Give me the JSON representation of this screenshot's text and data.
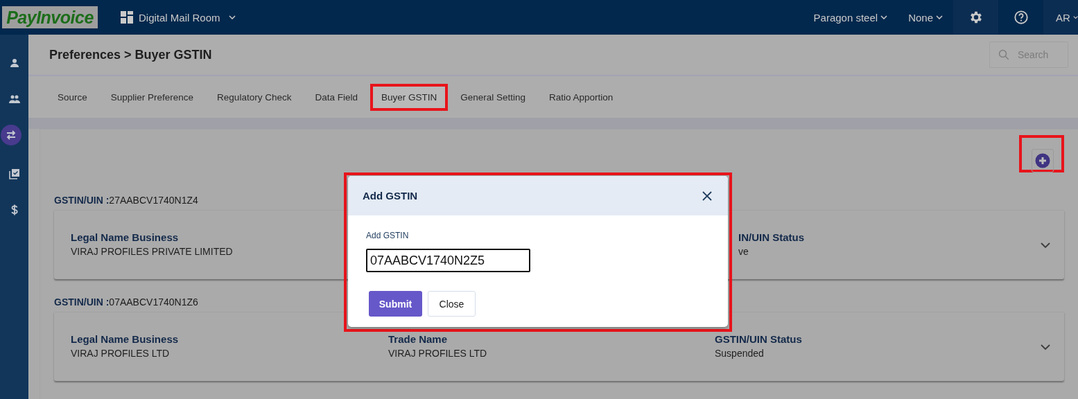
{
  "top_bar": {
    "logo": "PayInvoice",
    "module": "Digital Mail Room",
    "company": "Paragon steel",
    "filter": "None",
    "user": "AR"
  },
  "sidebar": {
    "items": [
      {
        "selected": false
      },
      {
        "selected": false
      },
      {
        "selected": true
      },
      {
        "selected": false
      },
      {
        "selected": false
      }
    ]
  },
  "page_title": "Preferences > Buyer GSTIN",
  "search": {
    "placeholder": "Search"
  },
  "tabs": [
    {
      "label": "Source",
      "selected": false,
      "highlighted": false
    },
    {
      "label": "Supplier Preference",
      "selected": false,
      "highlighted": false
    },
    {
      "label": "Regulatory Check",
      "selected": false,
      "highlighted": false
    },
    {
      "label": "Data Field",
      "selected": false,
      "highlighted": false
    },
    {
      "label": "Buyer GSTIN",
      "selected": true,
      "highlighted": true
    },
    {
      "label": "General Setting",
      "selected": false,
      "highlighted": false
    },
    {
      "label": "Ratio Apportion",
      "selected": false,
      "highlighted": false
    }
  ],
  "add_button": {
    "highlighted": true
  },
  "gstin_cards": [
    {
      "gstin_label": "GSTIN/UIN :",
      "gstin": "27AABCV1740N1Z4",
      "expanded": false,
      "fields": [
        {
          "kind": "legal",
          "label": "Legal Name Business",
          "value": "VIRAJ PROFILES PRIVATE LIMITED"
        },
        {
          "kind": "status",
          "label": "IN/UIN Status",
          "value": "ve"
        }
      ]
    },
    {
      "gstin_label": "GSTIN/UIN :",
      "gstin": "07AABCV1740N1Z6",
      "expanded": false,
      "fields": [
        {
          "kind": "legal",
          "label": "Legal Name Business",
          "value": "VIRAJ PROFILES LTD"
        },
        {
          "kind": "trade",
          "label": "Trade Name",
          "value": "VIRAJ PROFILES LTD"
        },
        {
          "kind": "status",
          "label": "GSTIN/UIN Status",
          "value": "Suspended"
        }
      ]
    }
  ],
  "modal": {
    "title": "Add GSTIN",
    "highlighted": true,
    "field_label": "Add GSTIN",
    "value": "07AABCV1740N2Z5",
    "buttons": [
      {
        "label": "Submit",
        "kind": "primary"
      },
      {
        "label": "Close",
        "kind": "secondary"
      }
    ]
  }
}
